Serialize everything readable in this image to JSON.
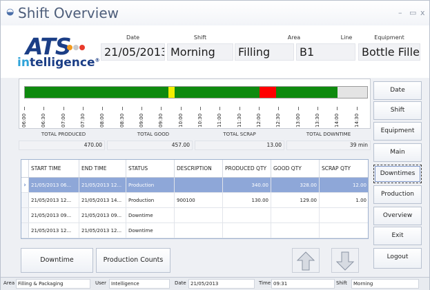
{
  "window": {
    "title": "Shift Overview",
    "minimize": "–",
    "maximize": "▭",
    "close": "x"
  },
  "logo": {
    "brand": "ATS",
    "sub_in": "in",
    "sub_rest": "telligence",
    "mark": "®"
  },
  "header": {
    "date": {
      "label": "Date",
      "value": "21/05/2013"
    },
    "shift": {
      "label": "Shift",
      "value": "Morning"
    },
    "area": {
      "label": "Area",
      "value": "Filling"
    },
    "line": {
      "label": "Line",
      "value": "B1"
    },
    "equipment": {
      "label": "Equipment",
      "value": "Bottle Filler"
    }
  },
  "timeline": {
    "colors": {
      "production": "#0e8a0e",
      "idle": "#f2ee00",
      "downtime": "#ff0000",
      "empty": "#e4e4e4"
    },
    "start_time": "06:00",
    "end_time": "14:45",
    "segments": [
      {
        "state": "production",
        "start": "06:00",
        "end": "09:40"
      },
      {
        "state": "idle",
        "start": "09:40",
        "end": "09:50"
      },
      {
        "state": "production",
        "start": "09:50",
        "end": "12:00"
      },
      {
        "state": "downtime",
        "start": "12:00",
        "end": "12:25"
      },
      {
        "state": "production",
        "start": "12:25",
        "end": "14:00"
      }
    ],
    "ticks": [
      "06:00",
      "06:30",
      "07:00",
      "07:30",
      "08:00",
      "08:30",
      "09:00",
      "09:30",
      "10:00",
      "10:30",
      "11:00",
      "11:30",
      "12:00",
      "12:30",
      "13:00",
      "13:30",
      "14:00",
      "14:30"
    ]
  },
  "totals": {
    "produced": {
      "label": "TOTAL PRODUCED",
      "value": "470.00"
    },
    "good": {
      "label": "TOTAL GOOD",
      "value": "457.00"
    },
    "scrap": {
      "label": "TOTAL SCRAP",
      "value": "13.00"
    },
    "downtime": {
      "label": "TOTAL DOWNTIME",
      "value": "39 min"
    }
  },
  "grid": {
    "columns": [
      "START TIME",
      "END TIME",
      "STATUS",
      "DESCRIPTION",
      "PRODUCED QTY",
      "GOOD QTY",
      "SCRAP QTY"
    ],
    "selector_glyph": "›",
    "rows": [
      {
        "start": "21/05/2013 06...",
        "end": "21/05/2013 12...",
        "status": "Production",
        "description": "",
        "produced": "340.00",
        "good": "328.00",
        "scrap": "12.00",
        "selected": true
      },
      {
        "start": "21/05/2013 12...",
        "end": "21/05/2013 14...",
        "status": "Production",
        "description": "900100",
        "produced": "130.00",
        "good": "129.00",
        "scrap": "1.00",
        "selected": false
      },
      {
        "start": "21/05/2013 09...",
        "end": "21/05/2013 09...",
        "status": "Downtime",
        "description": "",
        "produced": "",
        "good": "",
        "scrap": "",
        "selected": false
      },
      {
        "start": "21/05/2013 12...",
        "end": "21/05/2013 12...",
        "status": "Downtime",
        "description": "",
        "produced": "",
        "good": "",
        "scrap": "",
        "selected": false
      }
    ]
  },
  "side_buttons": [
    "Date",
    "Shift",
    "Equipment",
    "Main",
    "Downtimes",
    "Production",
    "Overview",
    "Exit",
    "Logout"
  ],
  "active_side_button": "Downtimes",
  "bottom_buttons": {
    "downtime": "Downtime",
    "production_counts": "Production Counts"
  },
  "statusbar": {
    "area": {
      "label": "Area",
      "value": "Filling & Packaging"
    },
    "user": {
      "label": "User",
      "value": "Intelligence"
    },
    "date": {
      "label": "Date",
      "value": "21/05/2013"
    },
    "time": {
      "label": "Time",
      "value": "09:31"
    },
    "shift": {
      "label": "Shift",
      "value": "Morning"
    }
  }
}
